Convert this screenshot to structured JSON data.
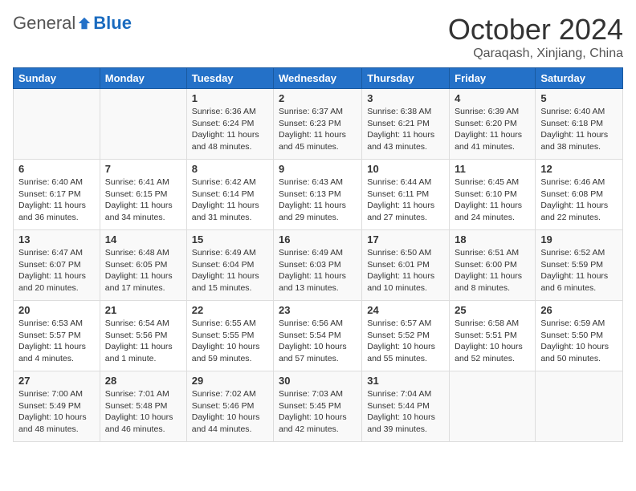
{
  "logo": {
    "general": "General",
    "blue": "Blue"
  },
  "title": "October 2024",
  "location": "Qaraqash, Xinjiang, China",
  "weekdays": [
    "Sunday",
    "Monday",
    "Tuesday",
    "Wednesday",
    "Thursday",
    "Friday",
    "Saturday"
  ],
  "weeks": [
    [
      null,
      null,
      {
        "day": 1,
        "sunrise": "6:36 AM",
        "sunset": "6:24 PM",
        "daylight": "11 hours and 48 minutes."
      },
      {
        "day": 2,
        "sunrise": "6:37 AM",
        "sunset": "6:23 PM",
        "daylight": "11 hours and 45 minutes."
      },
      {
        "day": 3,
        "sunrise": "6:38 AM",
        "sunset": "6:21 PM",
        "daylight": "11 hours and 43 minutes."
      },
      {
        "day": 4,
        "sunrise": "6:39 AM",
        "sunset": "6:20 PM",
        "daylight": "11 hours and 41 minutes."
      },
      {
        "day": 5,
        "sunrise": "6:40 AM",
        "sunset": "6:18 PM",
        "daylight": "11 hours and 38 minutes."
      }
    ],
    [
      {
        "day": 6,
        "sunrise": "6:40 AM",
        "sunset": "6:17 PM",
        "daylight": "11 hours and 36 minutes."
      },
      {
        "day": 7,
        "sunrise": "6:41 AM",
        "sunset": "6:15 PM",
        "daylight": "11 hours and 34 minutes."
      },
      {
        "day": 8,
        "sunrise": "6:42 AM",
        "sunset": "6:14 PM",
        "daylight": "11 hours and 31 minutes."
      },
      {
        "day": 9,
        "sunrise": "6:43 AM",
        "sunset": "6:13 PM",
        "daylight": "11 hours and 29 minutes."
      },
      {
        "day": 10,
        "sunrise": "6:44 AM",
        "sunset": "6:11 PM",
        "daylight": "11 hours and 27 minutes."
      },
      {
        "day": 11,
        "sunrise": "6:45 AM",
        "sunset": "6:10 PM",
        "daylight": "11 hours and 24 minutes."
      },
      {
        "day": 12,
        "sunrise": "6:46 AM",
        "sunset": "6:08 PM",
        "daylight": "11 hours and 22 minutes."
      }
    ],
    [
      {
        "day": 13,
        "sunrise": "6:47 AM",
        "sunset": "6:07 PM",
        "daylight": "11 hours and 20 minutes."
      },
      {
        "day": 14,
        "sunrise": "6:48 AM",
        "sunset": "6:05 PM",
        "daylight": "11 hours and 17 minutes."
      },
      {
        "day": 15,
        "sunrise": "6:49 AM",
        "sunset": "6:04 PM",
        "daylight": "11 hours and 15 minutes."
      },
      {
        "day": 16,
        "sunrise": "6:49 AM",
        "sunset": "6:03 PM",
        "daylight": "11 hours and 13 minutes."
      },
      {
        "day": 17,
        "sunrise": "6:50 AM",
        "sunset": "6:01 PM",
        "daylight": "11 hours and 10 minutes."
      },
      {
        "day": 18,
        "sunrise": "6:51 AM",
        "sunset": "6:00 PM",
        "daylight": "11 hours and 8 minutes."
      },
      {
        "day": 19,
        "sunrise": "6:52 AM",
        "sunset": "5:59 PM",
        "daylight": "11 hours and 6 minutes."
      }
    ],
    [
      {
        "day": 20,
        "sunrise": "6:53 AM",
        "sunset": "5:57 PM",
        "daylight": "11 hours and 4 minutes."
      },
      {
        "day": 21,
        "sunrise": "6:54 AM",
        "sunset": "5:56 PM",
        "daylight": "11 hours and 1 minute."
      },
      {
        "day": 22,
        "sunrise": "6:55 AM",
        "sunset": "5:55 PM",
        "daylight": "10 hours and 59 minutes."
      },
      {
        "day": 23,
        "sunrise": "6:56 AM",
        "sunset": "5:54 PM",
        "daylight": "10 hours and 57 minutes."
      },
      {
        "day": 24,
        "sunrise": "6:57 AM",
        "sunset": "5:52 PM",
        "daylight": "10 hours and 55 minutes."
      },
      {
        "day": 25,
        "sunrise": "6:58 AM",
        "sunset": "5:51 PM",
        "daylight": "10 hours and 52 minutes."
      },
      {
        "day": 26,
        "sunrise": "6:59 AM",
        "sunset": "5:50 PM",
        "daylight": "10 hours and 50 minutes."
      }
    ],
    [
      {
        "day": 27,
        "sunrise": "7:00 AM",
        "sunset": "5:49 PM",
        "daylight": "10 hours and 48 minutes."
      },
      {
        "day": 28,
        "sunrise": "7:01 AM",
        "sunset": "5:48 PM",
        "daylight": "10 hours and 46 minutes."
      },
      {
        "day": 29,
        "sunrise": "7:02 AM",
        "sunset": "5:46 PM",
        "daylight": "10 hours and 44 minutes."
      },
      {
        "day": 30,
        "sunrise": "7:03 AM",
        "sunset": "5:45 PM",
        "daylight": "10 hours and 42 minutes."
      },
      {
        "day": 31,
        "sunrise": "7:04 AM",
        "sunset": "5:44 PM",
        "daylight": "10 hours and 39 minutes."
      },
      null,
      null
    ]
  ]
}
